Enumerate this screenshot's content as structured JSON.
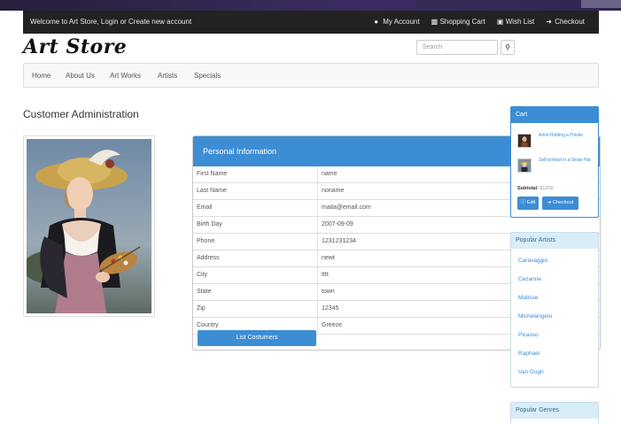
{
  "colors": {
    "topbar": "#222222",
    "primary": "#3c8dd4",
    "info_head": "#d9edf7"
  },
  "topbar": {
    "welcome": "Welcome to Art Store, Login or Create new account",
    "links": [
      {
        "label": "My Account",
        "icon": "user-icon"
      },
      {
        "label": "Shopping Cart",
        "icon": "cart-icon"
      },
      {
        "label": "Wish List",
        "icon": "gift-icon"
      },
      {
        "label": "Checkout",
        "icon": "arrow-right-icon"
      }
    ]
  },
  "brand": "Art Store",
  "search": {
    "placeholder": "Search",
    "icon": "search-icon"
  },
  "nav": [
    "Home",
    "About Us",
    "Art Works",
    "Artists",
    "Specials"
  ],
  "page_title": "Customer Administration",
  "personal_info": {
    "title": "Personal Information",
    "rows": [
      {
        "label": "First Name",
        "value": "name"
      },
      {
        "label": "Last Name",
        "value": "noname"
      },
      {
        "label": "Email",
        "value": "maila@email.com"
      },
      {
        "label": "Birth Day",
        "value": "2007-09-09"
      },
      {
        "label": "Phone",
        "value": "1231231234"
      },
      {
        "label": "Address",
        "value": "newt"
      },
      {
        "label": "City",
        "value": "tttt"
      },
      {
        "label": "State",
        "value": "town"
      },
      {
        "label": "Zip",
        "value": "12345"
      },
      {
        "label": "Country",
        "value": "Greece"
      }
    ],
    "button": "List Costumers"
  },
  "cart": {
    "title": "Cart",
    "items": [
      "Artist Holding a Thistle",
      "Self-portrait in a Straw Hat"
    ],
    "subtotal_label": "Subtotal:",
    "subtotal_value": "$1200",
    "edit": "Edit",
    "checkout": "Checkout"
  },
  "popular_artists": {
    "title": "Popular Artists",
    "items": [
      "Caravaggio",
      "Cezanne",
      "Matisse",
      "Michelangelo",
      "Picasso",
      "Raphael",
      "Van Gogh"
    ]
  },
  "popular_genres": {
    "title": "Popular Genres"
  }
}
